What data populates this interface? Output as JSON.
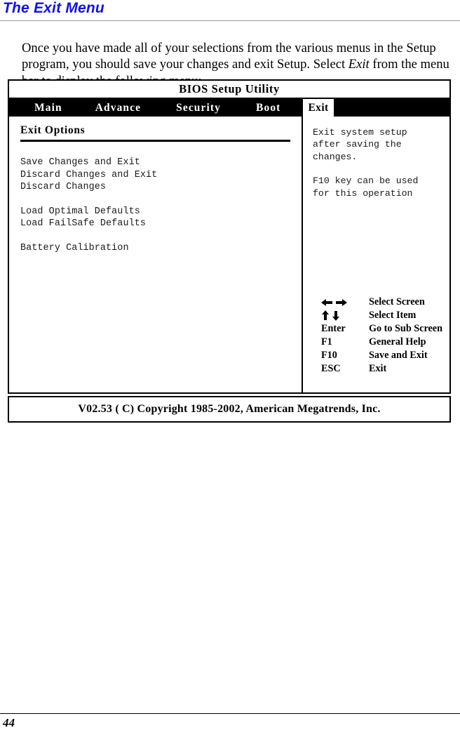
{
  "page": {
    "heading": "The Exit Menu",
    "intro_part1": "Once you have made all of your selections from the various menus in the Setup program, you should save your changes and exit Setup.  Select ",
    "intro_italic": "Exit",
    "intro_part2": " from the menu bar to display the following menu:",
    "page_number": "44"
  },
  "bios": {
    "title": "BIOS Setup Utility",
    "menu_tabs": [
      {
        "label": "Main",
        "selected": false
      },
      {
        "label": "Advance",
        "selected": false
      },
      {
        "label": "Security",
        "selected": false
      },
      {
        "label": "Boot",
        "selected": false
      },
      {
        "label": "Exit",
        "selected": true
      }
    ],
    "section_title": "Exit Options",
    "options": [
      "Save Changes and Exit",
      "Discard Changes and Exit",
      "Discard Changes",
      "Load Optimal Defaults",
      "Load FailSafe Defaults",
      "Battery Calibration"
    ],
    "help": {
      "line1": "Exit system setup",
      "line2": "after saving the",
      "line3": "changes.",
      "line4": "F10 key can be used",
      "line5": "for this operation"
    },
    "key_legend": [
      {
        "key": "←→",
        "icon": "left-right-arrow-icon",
        "desc": "Select Screen"
      },
      {
        "key": "↑↓",
        "icon": "up-down-arrow-icon",
        "desc": "Select Item"
      },
      {
        "key": "Enter",
        "icon": "",
        "desc": "Go to Sub Screen"
      },
      {
        "key": "F1",
        "icon": "",
        "desc": "General Help"
      },
      {
        "key": "F10",
        "icon": "",
        "desc": "Save and Exit"
      },
      {
        "key": "ESC",
        "icon": "",
        "desc": "Exit"
      }
    ],
    "footer": "V02.53  ( C) Copyright 1985-2002, American Megatrends, Inc."
  },
  "colors": {
    "heading": "#1010ee",
    "menubar_bg": "#000000",
    "selected_tab_bg": "#ffffff",
    "text": "#000000"
  }
}
